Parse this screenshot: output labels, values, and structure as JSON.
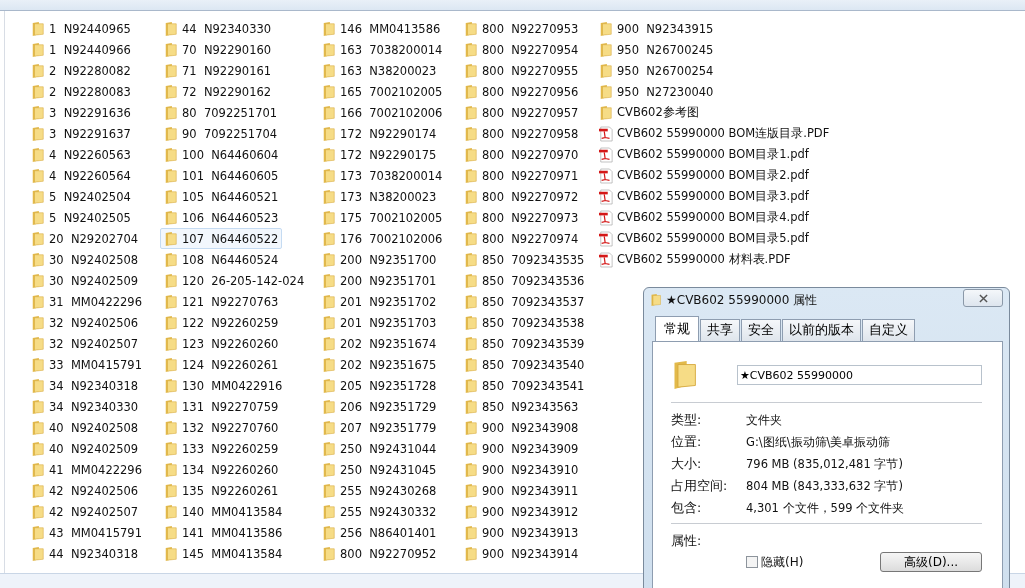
{
  "columns": [
    {
      "items": [
        {
          "name": "1  N92440965",
          "kind": "folder",
          "selected": false
        },
        {
          "name": "1  N92440966",
          "kind": "folder",
          "selected": false
        },
        {
          "name": "2  N92280082",
          "kind": "folder",
          "selected": false
        },
        {
          "name": "2  N92280083",
          "kind": "folder",
          "selected": false
        },
        {
          "name": "3  N92291636",
          "kind": "folder",
          "selected": false
        },
        {
          "name": "3  N92291637",
          "kind": "folder",
          "selected": false
        },
        {
          "name": "4  N92260563",
          "kind": "folder",
          "selected": false
        },
        {
          "name": "4  N92260564",
          "kind": "folder",
          "selected": false
        },
        {
          "name": "5  N92402504",
          "kind": "folder",
          "selected": false
        },
        {
          "name": "5  N92402505",
          "kind": "folder",
          "selected": false
        },
        {
          "name": "20  N29202704",
          "kind": "folder",
          "selected": false
        },
        {
          "name": "30  N92402508",
          "kind": "folder",
          "selected": false
        },
        {
          "name": "30  N92402509",
          "kind": "folder",
          "selected": false
        },
        {
          "name": "31  MM0422296",
          "kind": "folder",
          "selected": false
        },
        {
          "name": "32  N92402506",
          "kind": "folder",
          "selected": false
        },
        {
          "name": "32  N92402507",
          "kind": "folder",
          "selected": false
        },
        {
          "name": "33  MM0415791",
          "kind": "folder",
          "selected": false
        },
        {
          "name": "34  N92340318",
          "kind": "folder",
          "selected": false
        },
        {
          "name": "34  N92340330",
          "kind": "folder",
          "selected": false
        },
        {
          "name": "40  N92402508",
          "kind": "folder",
          "selected": false
        },
        {
          "name": "40  N92402509",
          "kind": "folder",
          "selected": false
        },
        {
          "name": "41  MM0422296",
          "kind": "folder",
          "selected": false
        },
        {
          "name": "42  N92402506",
          "kind": "folder",
          "selected": false
        },
        {
          "name": "42  N92402507",
          "kind": "folder",
          "selected": false
        },
        {
          "name": "43  MM0415791",
          "kind": "folder",
          "selected": false
        },
        {
          "name": "44  N92340318",
          "kind": "folder",
          "selected": false
        }
      ]
    },
    {
      "items": [
        {
          "name": "44  N92340330",
          "kind": "folder",
          "selected": false
        },
        {
          "name": "70  N92290160",
          "kind": "folder",
          "selected": false
        },
        {
          "name": "71  N92290161",
          "kind": "folder",
          "selected": false
        },
        {
          "name": "72  N92290162",
          "kind": "folder",
          "selected": false
        },
        {
          "name": "80  7092251701",
          "kind": "folder",
          "selected": false
        },
        {
          "name": "90  7092251704",
          "kind": "folder",
          "selected": false
        },
        {
          "name": "100  N64460604",
          "kind": "folder",
          "selected": false
        },
        {
          "name": "101  N64460605",
          "kind": "folder",
          "selected": false
        },
        {
          "name": "105  N64460521",
          "kind": "folder",
          "selected": false
        },
        {
          "name": "106  N64460523",
          "kind": "folder",
          "selected": false
        },
        {
          "name": "107  N64460522",
          "kind": "folder",
          "selected": true
        },
        {
          "name": "108  N64460524",
          "kind": "folder",
          "selected": false
        },
        {
          "name": "120  26-205-142-024",
          "kind": "folder",
          "selected": false
        },
        {
          "name": "121  N92270763",
          "kind": "folder",
          "selected": false
        },
        {
          "name": "122  N92260259",
          "kind": "folder",
          "selected": false
        },
        {
          "name": "123  N92260260",
          "kind": "folder",
          "selected": false
        },
        {
          "name": "124  N92260261",
          "kind": "folder",
          "selected": false
        },
        {
          "name": "130  MM0422916",
          "kind": "folder",
          "selected": false
        },
        {
          "name": "131  N92270759",
          "kind": "folder",
          "selected": false
        },
        {
          "name": "132  N92270760",
          "kind": "folder",
          "selected": false
        },
        {
          "name": "133  N92260259",
          "kind": "folder",
          "selected": false
        },
        {
          "name": "134  N92260260",
          "kind": "folder",
          "selected": false
        },
        {
          "name": "135  N92260261",
          "kind": "folder",
          "selected": false
        },
        {
          "name": "140  MM0413584",
          "kind": "folder",
          "selected": false
        },
        {
          "name": "141  MM0413586",
          "kind": "folder",
          "selected": false
        },
        {
          "name": "145  MM0413584",
          "kind": "folder",
          "selected": false
        }
      ]
    },
    {
      "items": [
        {
          "name": "146  MM0413586",
          "kind": "folder",
          "selected": false
        },
        {
          "name": "163  7038200014",
          "kind": "folder",
          "selected": false
        },
        {
          "name": "163  N38200023",
          "kind": "folder",
          "selected": false
        },
        {
          "name": "165  7002102005",
          "kind": "folder",
          "selected": false
        },
        {
          "name": "166  7002102006",
          "kind": "folder",
          "selected": false
        },
        {
          "name": "172  N92290174",
          "kind": "folder",
          "selected": false
        },
        {
          "name": "172  N92290175",
          "kind": "folder",
          "selected": false
        },
        {
          "name": "173  7038200014",
          "kind": "folder",
          "selected": false
        },
        {
          "name": "173  N38200023",
          "kind": "folder",
          "selected": false
        },
        {
          "name": "175  7002102005",
          "kind": "folder",
          "selected": false
        },
        {
          "name": "176  7002102006",
          "kind": "folder",
          "selected": false
        },
        {
          "name": "200  N92351700",
          "kind": "folder",
          "selected": false
        },
        {
          "name": "200  N92351701",
          "kind": "folder",
          "selected": false
        },
        {
          "name": "201  N92351702",
          "kind": "folder",
          "selected": false
        },
        {
          "name": "201  N92351703",
          "kind": "folder",
          "selected": false
        },
        {
          "name": "202  N92351674",
          "kind": "folder",
          "selected": false
        },
        {
          "name": "202  N92351675",
          "kind": "folder",
          "selected": false
        },
        {
          "name": "205  N92351728",
          "kind": "folder",
          "selected": false
        },
        {
          "name": "206  N92351729",
          "kind": "folder",
          "selected": false
        },
        {
          "name": "207  N92351779",
          "kind": "folder",
          "selected": false
        },
        {
          "name": "250  N92431044",
          "kind": "folder",
          "selected": false
        },
        {
          "name": "250  N92431045",
          "kind": "folder",
          "selected": false
        },
        {
          "name": "255  N92430268",
          "kind": "folder",
          "selected": false
        },
        {
          "name": "255  N92430332",
          "kind": "folder",
          "selected": false
        },
        {
          "name": "256  N86401401",
          "kind": "folder",
          "selected": false
        },
        {
          "name": "800  N92270952",
          "kind": "folder",
          "selected": false
        }
      ]
    },
    {
      "items": [
        {
          "name": "800  N92270953",
          "kind": "folder",
          "selected": false
        },
        {
          "name": "800  N92270954",
          "kind": "folder",
          "selected": false
        },
        {
          "name": "800  N92270955",
          "kind": "folder",
          "selected": false
        },
        {
          "name": "800  N92270956",
          "kind": "folder",
          "selected": false
        },
        {
          "name": "800  N92270957",
          "kind": "folder",
          "selected": false
        },
        {
          "name": "800  N92270958",
          "kind": "folder",
          "selected": false
        },
        {
          "name": "800  N92270970",
          "kind": "folder",
          "selected": false
        },
        {
          "name": "800  N92270971",
          "kind": "folder",
          "selected": false
        },
        {
          "name": "800  N92270972",
          "kind": "folder",
          "selected": false
        },
        {
          "name": "800  N92270973",
          "kind": "folder",
          "selected": false
        },
        {
          "name": "800  N92270974",
          "kind": "folder",
          "selected": false
        },
        {
          "name": "850  7092343535",
          "kind": "folder",
          "selected": false
        },
        {
          "name": "850  7092343536",
          "kind": "folder",
          "selected": false
        },
        {
          "name": "850  7092343537",
          "kind": "folder",
          "selected": false
        },
        {
          "name": "850  7092343538",
          "kind": "folder",
          "selected": false
        },
        {
          "name": "850  7092343539",
          "kind": "folder",
          "selected": false
        },
        {
          "name": "850  7092343540",
          "kind": "folder",
          "selected": false
        },
        {
          "name": "850  7092343541",
          "kind": "folder",
          "selected": false
        },
        {
          "name": "850  N92343563",
          "kind": "folder",
          "selected": false
        },
        {
          "name": "900  N92343908",
          "kind": "folder",
          "selected": false
        },
        {
          "name": "900  N92343909",
          "kind": "folder",
          "selected": false
        },
        {
          "name": "900  N92343910",
          "kind": "folder",
          "selected": false
        },
        {
          "name": "900  N92343911",
          "kind": "folder",
          "selected": false
        },
        {
          "name": "900  N92343912",
          "kind": "folder",
          "selected": false
        },
        {
          "name": "900  N92343913",
          "kind": "folder",
          "selected": false
        },
        {
          "name": "900  N92343914",
          "kind": "folder",
          "selected": false
        }
      ]
    },
    {
      "items": [
        {
          "name": "900  N92343915",
          "kind": "folder",
          "selected": false
        },
        {
          "name": "950  N26700245",
          "kind": "folder",
          "selected": false
        },
        {
          "name": "950  N26700254",
          "kind": "folder",
          "selected": false
        },
        {
          "name": "950  N27230040",
          "kind": "folder",
          "selected": false
        },
        {
          "name": "CVB602参考图",
          "kind": "folder",
          "selected": false
        },
        {
          "name": "CVB602 55990000 BOM连版目录.PDF",
          "kind": "pdf",
          "selected": false
        },
        {
          "name": "CVB602 55990000 BOM目录1.pdf",
          "kind": "pdf",
          "selected": false
        },
        {
          "name": "CVB602 55990000 BOM目录2.pdf",
          "kind": "pdf",
          "selected": false
        },
        {
          "name": "CVB602 55990000 BOM目录3.pdf",
          "kind": "pdf",
          "selected": false
        },
        {
          "name": "CVB602 55990000 BOM目录4.pdf",
          "kind": "pdf",
          "selected": false
        },
        {
          "name": "CVB602 55990000 BOM目录5.pdf",
          "kind": "pdf",
          "selected": false
        },
        {
          "name": "CVB602 55990000 材料表.PDF",
          "kind": "pdf",
          "selected": false
        }
      ]
    }
  ],
  "dialog": {
    "title": "★CVB602 55990000 属性",
    "tabs": [
      {
        "label": "常规",
        "selected": true
      },
      {
        "label": "共享",
        "selected": false
      },
      {
        "label": "安全",
        "selected": false
      },
      {
        "label": "以前的版本",
        "selected": false
      },
      {
        "label": "自定义",
        "selected": false
      }
    ],
    "name_field": {
      "value": "★CVB602 55990000"
    },
    "properties": [
      {
        "label": "类型:",
        "value": "文件夹"
      },
      {
        "label": "位置:",
        "value": "G:\\图纸\\振动筛\\美卓振动筛"
      },
      {
        "label": "大小:",
        "value": "796 MB (835,012,481 字节)"
      },
      {
        "label": "占用空间:",
        "value": "804 MB (843,333,632 字节)"
      },
      {
        "label": "包含:",
        "value": "4,301 个文件，599 个文件夹"
      }
    ],
    "attributes_label": "属性:",
    "hidden_checkbox": {
      "label": "隐藏(H)",
      "checked": false
    },
    "advanced_button": "高级(D)..."
  }
}
